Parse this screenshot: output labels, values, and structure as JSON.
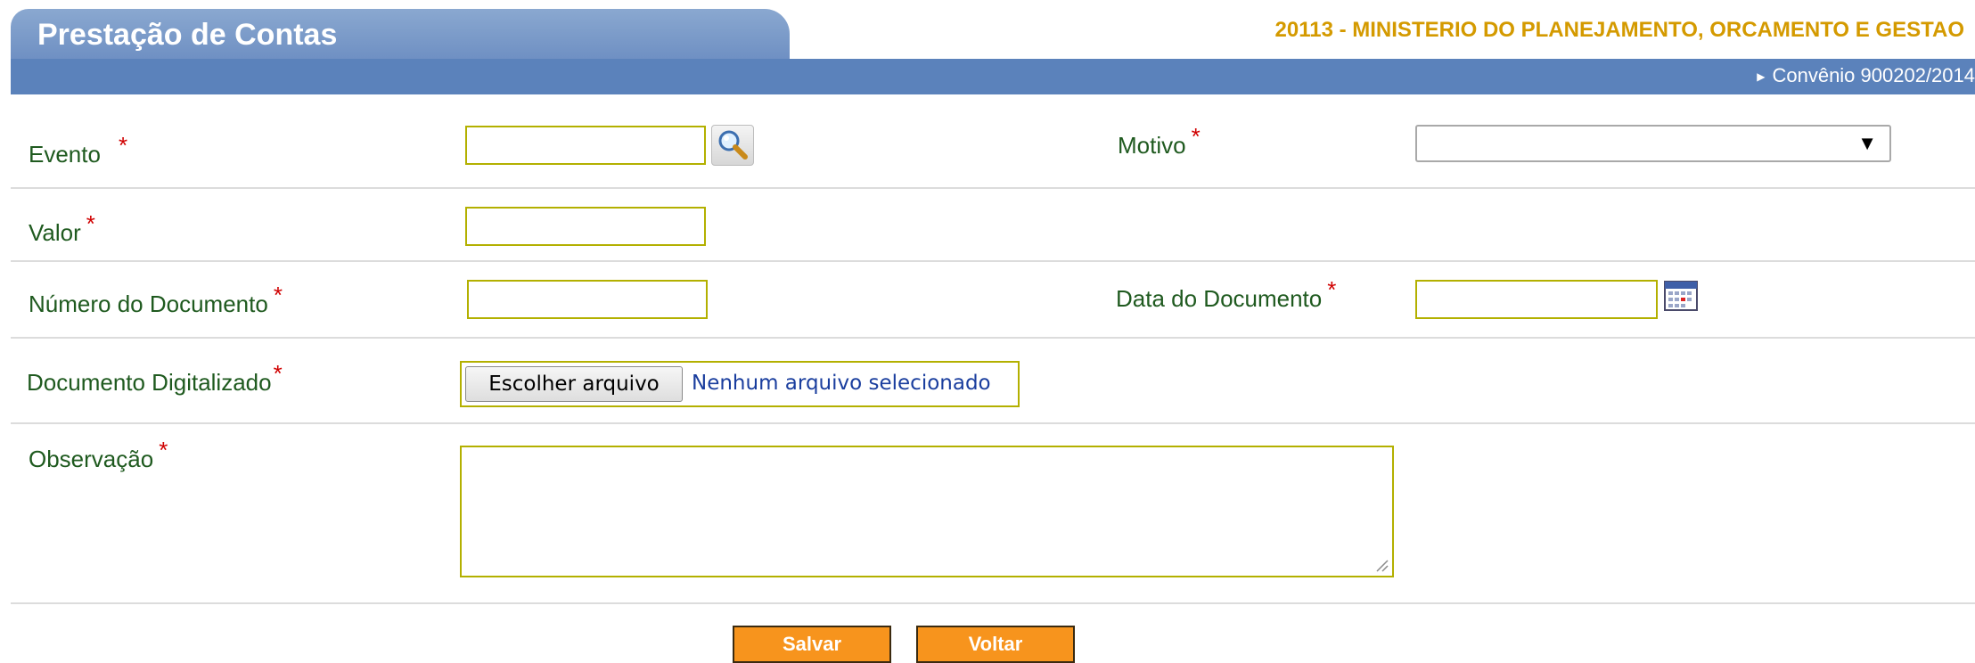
{
  "header": {
    "title": "Prestação de Contas",
    "org": "20113 - MINISTERIO DO PLANEJAMENTO, ORCAMENTO E GESTAO",
    "convenio": "Convênio 900202/2014"
  },
  "form": {
    "evento": {
      "label": "Evento",
      "required": "*",
      "value": ""
    },
    "motivo": {
      "label": "Motivo",
      "required": "*",
      "selected": ""
    },
    "valor": {
      "label": "Valor",
      "required": "*",
      "value": ""
    },
    "numero_documento": {
      "label": "Número do Documento",
      "required": "*",
      "value": ""
    },
    "data_documento": {
      "label": "Data do Documento",
      "required": "*",
      "value": ""
    },
    "documento_digitalizado": {
      "label": "Documento Digitalizado",
      "required": "*",
      "button_label": "Escolher arquivo",
      "status": "Nenhum arquivo selecionado"
    },
    "observacao": {
      "label": "Observação",
      "required": "*",
      "value": ""
    }
  },
  "actions": {
    "save_label": "Salvar",
    "back_label": "Voltar"
  },
  "icons": {
    "search": "magnifier-icon",
    "calendar": "calendar-icon",
    "dropdown": "dropdown-caret-icon"
  },
  "colors": {
    "header_blue": "#5b82bb",
    "org_text": "#d49a00",
    "label_green": "#1f5a1f",
    "required_red": "#d00000",
    "input_border": "#b3b000",
    "button_orange": "#f7941d"
  }
}
